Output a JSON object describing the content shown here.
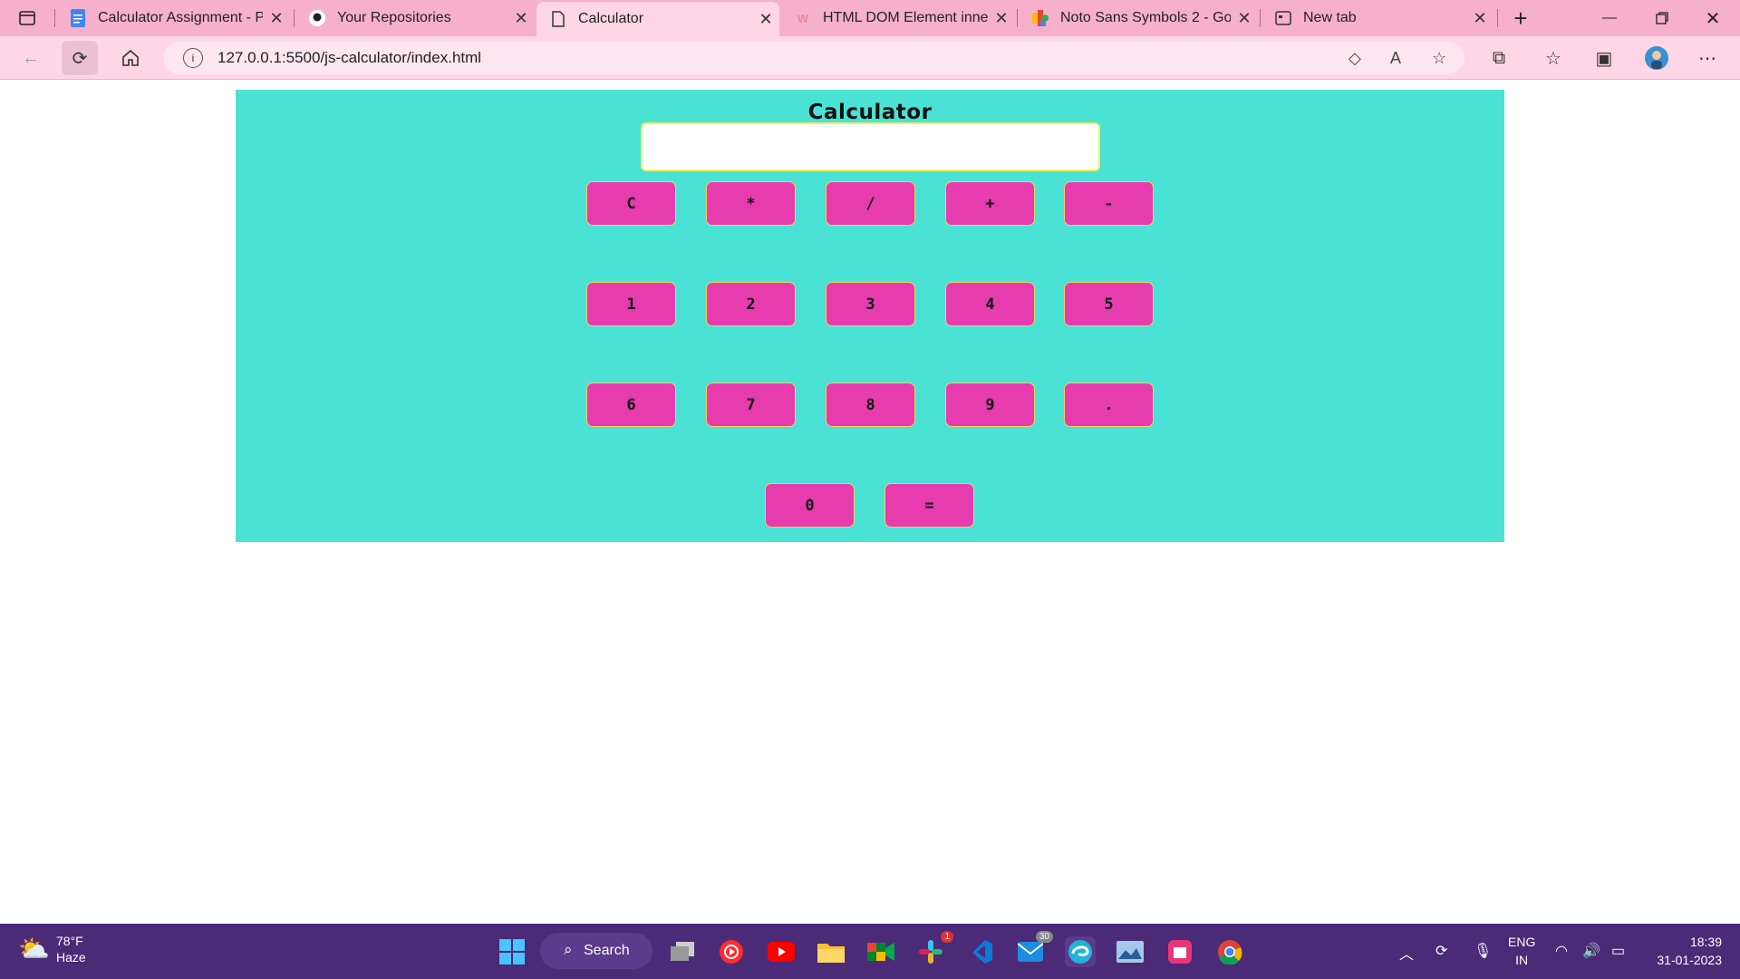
{
  "tabs": [
    {
      "title": "Calculator Assignment - Prt",
      "icon": "google-docs-icon"
    },
    {
      "title": "Your Repositories",
      "icon": "github-icon"
    },
    {
      "title": "Calculator",
      "icon": "page-icon"
    },
    {
      "title": "HTML DOM Element innerTe",
      "icon": "w3schools-icon"
    },
    {
      "title": "Noto Sans Symbols 2 - Goo",
      "icon": "google-fonts-icon"
    },
    {
      "title": "New tab",
      "icon": "new-tab-icon"
    }
  ],
  "address": {
    "url": "127.0.0.1:5500/js-calculator/index.html"
  },
  "calculator": {
    "title": "Calculator",
    "display_value": "",
    "keys": [
      "C",
      "*",
      "/",
      "+",
      "-",
      "1",
      "2",
      "3",
      "4",
      "5",
      "6",
      "7",
      "8",
      "9",
      ".",
      "0",
      "="
    ]
  },
  "taskbar": {
    "weather_temp": "78°F",
    "weather_desc": "Haze",
    "search_label": "Search",
    "slack_badge": "1",
    "mail_badge": "30",
    "lang_top": "ENG",
    "lang_bottom": "IN",
    "time": "18:39",
    "date": "31-01-2023"
  },
  "colors": {
    "calc_bg": "#4ae2d4",
    "key_bg": "#e63cae",
    "tabstrip": "#f7b0cb"
  }
}
